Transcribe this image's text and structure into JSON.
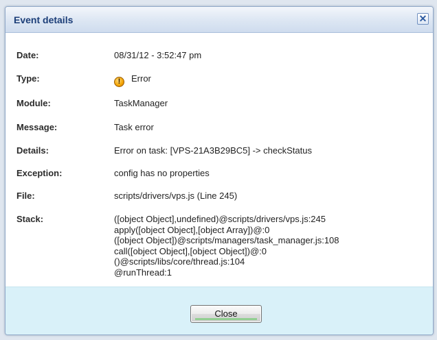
{
  "dialog": {
    "title": "Event details",
    "close_glyph": "✕",
    "close_button_label": "Close"
  },
  "fields": {
    "date": {
      "label": "Date:",
      "value": "08/31/12 - 3:52:47 pm"
    },
    "type": {
      "label": "Type:",
      "value": "Error",
      "icon": "error-icon"
    },
    "module": {
      "label": "Module:",
      "value": "TaskManager"
    },
    "message": {
      "label": "Message:",
      "value": "Task error"
    },
    "details": {
      "label": "Details:",
      "value": "Error on task: [VPS-21A3B29BC5] -> checkStatus"
    },
    "exception": {
      "label": "Exception:",
      "value": "config has no properties"
    },
    "file": {
      "label": "File:",
      "value": "scripts/drivers/vps.js (Line 245)"
    },
    "stack": {
      "label": "Stack:",
      "lines": [
        "([object Object],undefined)@scripts/drivers/vps.js:245",
        "apply([object Object],[object Array])@:0",
        "([object Object])@scripts/managers/task_manager.js:108",
        "call([object Object],[object Object])@:0",
        "()@scripts/libs/core/thread.js:104",
        "@runThread:1"
      ]
    }
  },
  "colors": {
    "title_text": "#1c3e78",
    "footer_bg": "#d9f1f9",
    "error_icon": "#f2a200"
  }
}
